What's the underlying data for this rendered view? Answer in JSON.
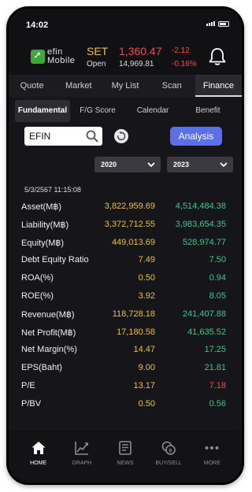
{
  "status": {
    "time": "14:02"
  },
  "logo": {
    "line1": "efin",
    "line2": "Mobile"
  },
  "market": {
    "name": "SET",
    "index": "1,360.47",
    "change": "-2.12",
    "change_pct": "-0.16%",
    "open_label": "Open",
    "open_value": "14,969.81"
  },
  "main_tabs": [
    {
      "label": "Quote",
      "active": false
    },
    {
      "label": "Market",
      "active": false
    },
    {
      "label": "My List",
      "active": false
    },
    {
      "label": "Scan",
      "active": false
    },
    {
      "label": "Finance",
      "active": true
    }
  ],
  "sub_tabs": [
    {
      "label": "Fundamental",
      "active": true
    },
    {
      "label": "F/G Score",
      "active": false
    },
    {
      "label": "Calendar",
      "active": false
    },
    {
      "label": "Benefit",
      "active": false
    }
  ],
  "search": {
    "value": "EFIN"
  },
  "analysis_button": "Analysis",
  "years": {
    "year1": "2020",
    "year2": "2023"
  },
  "timestamp": "5/3/2567 11:15:08",
  "rows": [
    {
      "label": "Asset(M฿)",
      "v1": "3,822,959.69",
      "v2": "4,514,484.38"
    },
    {
      "label": "Liability(M฿)",
      "v1": "3,372,712.55",
      "v2": "3,983,654.35"
    },
    {
      "label": "Equity(M฿)",
      "v1": "449,013.69",
      "v2": "528,974.77"
    },
    {
      "label": "Debt Equity Ratio",
      "v1": "7.49",
      "v2": "7.50"
    },
    {
      "label": "ROA(%)",
      "v1": "0.50",
      "v2": "0.94"
    },
    {
      "label": "ROE(%)",
      "v1": "3.92",
      "v2": "8.05"
    },
    {
      "label": "Revenue(M฿)",
      "v1": "118,728.18",
      "v2": "241,407.88"
    },
    {
      "label": "Net Profit(M฿)",
      "v1": "17,180.58",
      "v2": "41,635.52"
    },
    {
      "label": "Net Margin(%)",
      "v1": "14.47",
      "v2": "17.25"
    },
    {
      "label": "EPS(Baht)",
      "v1": "9.00",
      "v2": "21.81"
    },
    {
      "label": "P/E",
      "v1": "13.17",
      "v2": "7.18"
    },
    {
      "label": "P/BV",
      "v1": "0.50",
      "v2": "0.56"
    }
  ],
  "colors": {
    "up": "#36c98a",
    "down": "#f04d4d",
    "accent": "#5b6fe8",
    "yellow": "#e8c23c"
  },
  "bottom_nav": [
    {
      "label": "HOME",
      "icon": "home-icon",
      "active": true
    },
    {
      "label": "GRAPH",
      "icon": "graph-icon",
      "active": false
    },
    {
      "label": "NEWS",
      "icon": "news-icon",
      "active": false
    },
    {
      "label": "BUY/SELL",
      "icon": "buy-sell-icon",
      "active": false
    },
    {
      "label": "MORE",
      "icon": "more-icon",
      "active": false
    }
  ]
}
